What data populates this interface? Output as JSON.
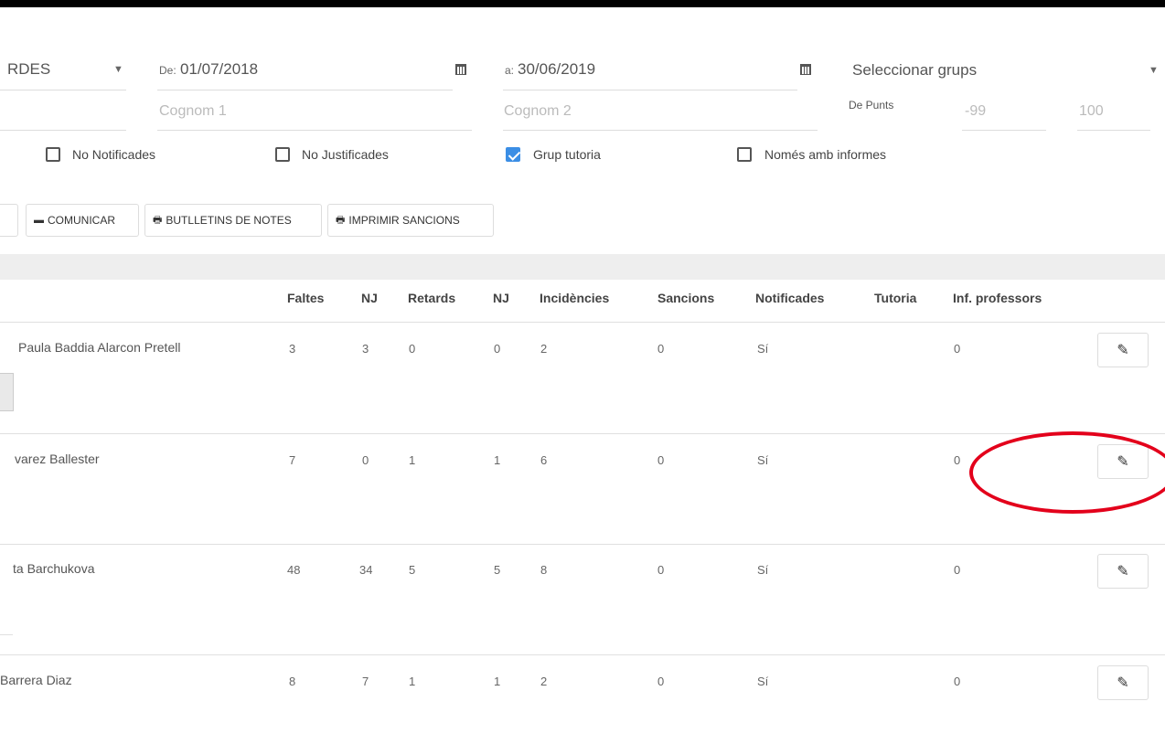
{
  "filters": {
    "type_select": "RDES",
    "date_from_label": "De:",
    "date_from": "01/07/2018",
    "date_to_label": "a:",
    "date_to": "30/06/2019",
    "groups_select": "Seleccionar grups",
    "surname1_placeholder": "Cognom 1",
    "surname2_placeholder": "Cognom 2",
    "points_label": "De Punts",
    "points_from": "-99",
    "points_to": "100"
  },
  "checkboxes": [
    {
      "label": "No Notificades",
      "checked": false
    },
    {
      "label": "No Justificades",
      "checked": false
    },
    {
      "label": "Grup tutoria",
      "checked": true
    },
    {
      "label": "Només amb informes",
      "checked": false
    }
  ],
  "actions": {
    "communicate": "COMUNICAR",
    "bulletins": "BUTLLETINS DE NOTES",
    "print_sanctions": "IMPRIMIR SANCIONS"
  },
  "table": {
    "headers": [
      "Faltes",
      "NJ",
      "Retards",
      "NJ",
      "Incidències",
      "Sancions",
      "Notificades",
      "Tutoria",
      "Inf. professors"
    ],
    "rows": [
      {
        "name": "Paula Baddia Alarcon Pretell",
        "faltes": "3",
        "nj1": "3",
        "retards": "0",
        "nj2": "0",
        "incidencies": "2",
        "sancions": "0",
        "notificades": "Sí",
        "tutoria": "",
        "inf": "0"
      },
      {
        "name": "varez Ballester",
        "faltes": "7",
        "nj1": "0",
        "retards": "1",
        "nj2": "1",
        "incidencies": "6",
        "sancions": "0",
        "notificades": "Sí",
        "tutoria": "",
        "inf": "0"
      },
      {
        "name": "ta Barchukova",
        "faltes": "48",
        "nj1": "34",
        "retards": "5",
        "nj2": "5",
        "incidencies": "8",
        "sancions": "0",
        "notificades": "Sí",
        "tutoria": "",
        "inf": "0"
      },
      {
        "name": "Barrera Diaz",
        "faltes": "8",
        "nj1": "7",
        "retards": "1",
        "nj2": "1",
        "incidencies": "2",
        "sancions": "0",
        "notificades": "Sí",
        "tutoria": "",
        "inf": "0"
      }
    ]
  },
  "colors": {
    "accent": "#3b8ee5",
    "annotation": "#e3001b"
  }
}
